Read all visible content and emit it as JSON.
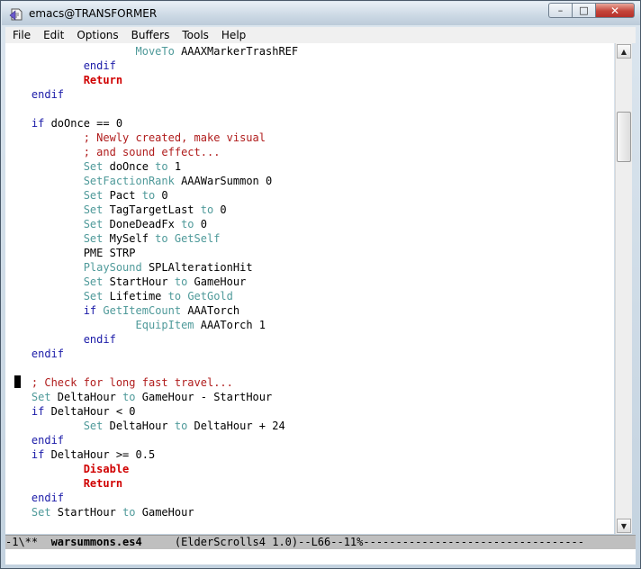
{
  "window": {
    "title": "emacs@TRANSFORMER",
    "minimize_glyph": "–",
    "maximize_glyph": "□",
    "close_glyph": "✕"
  },
  "menubar": [
    "File",
    "Edit",
    "Options",
    "Buffers",
    "Tools",
    "Help"
  ],
  "colors": {
    "keyword": "#1b1ba8",
    "function": "#4f9a9a",
    "comment": "#b01c1c",
    "statement": "#d00000"
  },
  "editor": {
    "lines": [
      [
        [
          "",
          ""
        ],
        [
          "fn",
          "                    MoveTo"
        ],
        [
          "",
          " AAAXMarkerTrashREF"
        ]
      ],
      [
        [
          "kw",
          "            endif"
        ]
      ],
      [
        [
          "st",
          "            Return"
        ]
      ],
      [
        [
          "kw",
          "    endif"
        ]
      ],
      [
        [
          "",
          ""
        ]
      ],
      [
        [
          "kw",
          "    if"
        ],
        [
          "",
          " doOnce == 0"
        ]
      ],
      [
        [
          "cm",
          "            ; Newly created, make visual"
        ]
      ],
      [
        [
          "cm",
          "            ; and sound effect..."
        ]
      ],
      [
        [
          "fn",
          "            Set"
        ],
        [
          "",
          " doOnce "
        ],
        [
          "fn",
          "to"
        ],
        [
          "",
          " 1"
        ]
      ],
      [
        [
          "fn",
          "            SetFactionRank"
        ],
        [
          "",
          " AAAWarSummon 0"
        ]
      ],
      [
        [
          "fn",
          "            Set"
        ],
        [
          "",
          " Pact "
        ],
        [
          "fn",
          "to"
        ],
        [
          "",
          " 0"
        ]
      ],
      [
        [
          "fn",
          "            Set"
        ],
        [
          "",
          " TagTargetLast "
        ],
        [
          "fn",
          "to"
        ],
        [
          "",
          " 0"
        ]
      ],
      [
        [
          "fn",
          "            Set"
        ],
        [
          "",
          " DoneDeadFx "
        ],
        [
          "fn",
          "to"
        ],
        [
          "",
          " 0"
        ]
      ],
      [
        [
          "fn",
          "            Set"
        ],
        [
          "",
          " MySelf "
        ],
        [
          "fn",
          "to"
        ],
        [
          "",
          " "
        ],
        [
          "fn",
          "GetSelf"
        ]
      ],
      [
        [
          "",
          "            PME STRP"
        ]
      ],
      [
        [
          "fn",
          "            PlaySound"
        ],
        [
          "",
          " SPLAlterationHit"
        ]
      ],
      [
        [
          "fn",
          "            Set"
        ],
        [
          "",
          " StartHour "
        ],
        [
          "fn",
          "to"
        ],
        [
          "",
          " GameHour"
        ]
      ],
      [
        [
          "fn",
          "            Set"
        ],
        [
          "",
          " Lifetime "
        ],
        [
          "fn",
          "to"
        ],
        [
          "",
          " "
        ],
        [
          "fn",
          "GetGold"
        ]
      ],
      [
        [
          "kw",
          "            if"
        ],
        [
          "",
          " "
        ],
        [
          "fn",
          "GetItemCount"
        ],
        [
          "",
          " AAATorch"
        ]
      ],
      [
        [
          "fn",
          "                    EquipItem"
        ],
        [
          "",
          " AAATorch 1"
        ]
      ],
      [
        [
          "kw",
          "            endif"
        ]
      ],
      [
        [
          "kw",
          "    endif"
        ]
      ],
      [
        [
          "",
          ""
        ]
      ],
      [
        [
          "cm",
          "    ; Check for long fast travel..."
        ]
      ],
      [
        [
          "fn",
          "    Set"
        ],
        [
          "",
          " DeltaHour "
        ],
        [
          "fn",
          "to"
        ],
        [
          "",
          " GameHour - StartHour"
        ]
      ],
      [
        [
          "kw",
          "    if"
        ],
        [
          "",
          " DeltaHour < 0"
        ]
      ],
      [
        [
          "fn",
          "            Set"
        ],
        [
          "",
          " DeltaHour "
        ],
        [
          "fn",
          "to"
        ],
        [
          "",
          " DeltaHour + 24"
        ]
      ],
      [
        [
          "kw",
          "    endif"
        ]
      ],
      [
        [
          "kw",
          "    if"
        ],
        [
          "",
          " DeltaHour >= 0.5"
        ]
      ],
      [
        [
          "st",
          "            Disable"
        ]
      ],
      [
        [
          "st",
          "            Return"
        ]
      ],
      [
        [
          "kw",
          "    endif"
        ]
      ],
      [
        [
          "fn",
          "    Set"
        ],
        [
          "",
          " StartHour "
        ],
        [
          "fn",
          "to"
        ],
        [
          "",
          " GameHour"
        ]
      ]
    ]
  },
  "scrollbar": {
    "position_fraction": 0.11
  },
  "modeline": {
    "prefix": "-1\\**  ",
    "buffer": "warsummons.es4",
    "rest": "     (ElderScrolls4 1.0)--L66--11%----------------------------------"
  }
}
